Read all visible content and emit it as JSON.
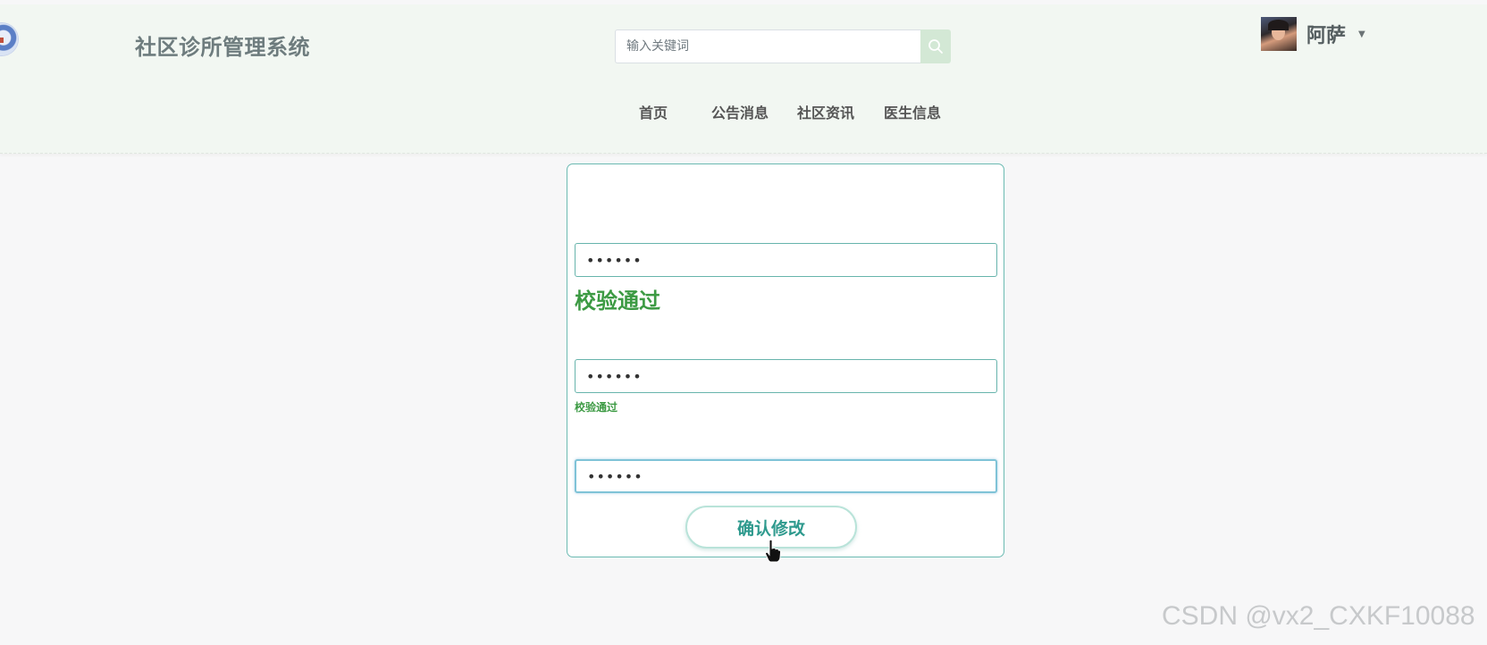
{
  "header": {
    "site_title": "社区诊所管理系统",
    "logo_icon": "temple-emblem-logo",
    "search": {
      "placeholder": "输入关键词",
      "value": "",
      "button_icon": "search-icon"
    },
    "user": {
      "name": "阿萨",
      "avatar_icon": "user-avatar",
      "caret_icon": "caret-down-icon",
      "caret_glyph": "▼"
    },
    "nav": [
      {
        "label": "首页"
      },
      {
        "label": "公告消息"
      },
      {
        "label": "社区资讯"
      },
      {
        "label": "医生信息"
      }
    ]
  },
  "form": {
    "fields": [
      {
        "value": "••••••",
        "validation": "校验通过"
      },
      {
        "value": "••••••",
        "validation": "校验通过"
      },
      {
        "value": "••••••",
        "validation": ""
      }
    ],
    "submit_label": "确认修改"
  },
  "watermark": "CSDN @vx2_CXKF10088",
  "colors": {
    "header_bg": "#f2f7f2",
    "accent_teal": "#2f9a8e",
    "card_border": "#6bbab2",
    "valid_green": "#3c9a43",
    "search_button_bg": "#d3e8d5"
  }
}
